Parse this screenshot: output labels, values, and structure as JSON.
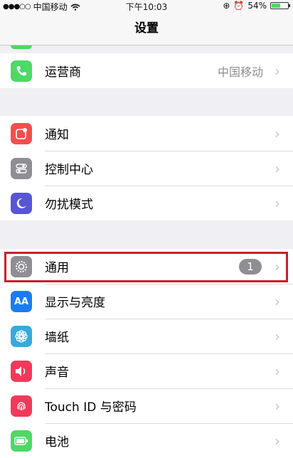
{
  "status_bar": {
    "carrier": "中国移动",
    "time": "下午10:03",
    "battery_percent": "54%",
    "battery_level": 0.54
  },
  "nav": {
    "title": "设置"
  },
  "groups": {
    "carrier_group": {
      "carrier_row": {
        "label": "运营商",
        "detail": "中国移动",
        "icon": "phone-icon",
        "color": "#4cd964"
      }
    },
    "notify_group": {
      "notifications": {
        "label": "通知",
        "icon": "notifications-icon",
        "color": "#f64e4e"
      },
      "control_center": {
        "label": "控制中心",
        "icon": "control-center-icon",
        "color": "#8e8e93"
      },
      "do_not_disturb": {
        "label": "勿扰模式",
        "icon": "moon-icon",
        "color": "#5856d6"
      }
    },
    "general_group": {
      "general": {
        "label": "通用",
        "badge": "1",
        "icon": "gear-icon",
        "color": "#8e8e93"
      },
      "display": {
        "label": "显示与亮度",
        "icon": "display-brightness-icon",
        "color": "#1a7cf5"
      },
      "wallpaper": {
        "label": "墙纸",
        "icon": "wallpaper-flower-icon",
        "color": "#36aadc"
      },
      "sounds": {
        "label": "声音",
        "icon": "speaker-icon",
        "color": "#f2395b"
      },
      "touch_id": {
        "label": "Touch ID 与密码",
        "icon": "fingerprint-icon",
        "color": "#f2395b"
      },
      "battery": {
        "label": "电池",
        "icon": "battery-icon",
        "color": "#4cd964"
      }
    }
  },
  "chevron": "›",
  "accent_colors": {
    "highlight": "#c8202b",
    "system_gray": "#8e8e93"
  }
}
